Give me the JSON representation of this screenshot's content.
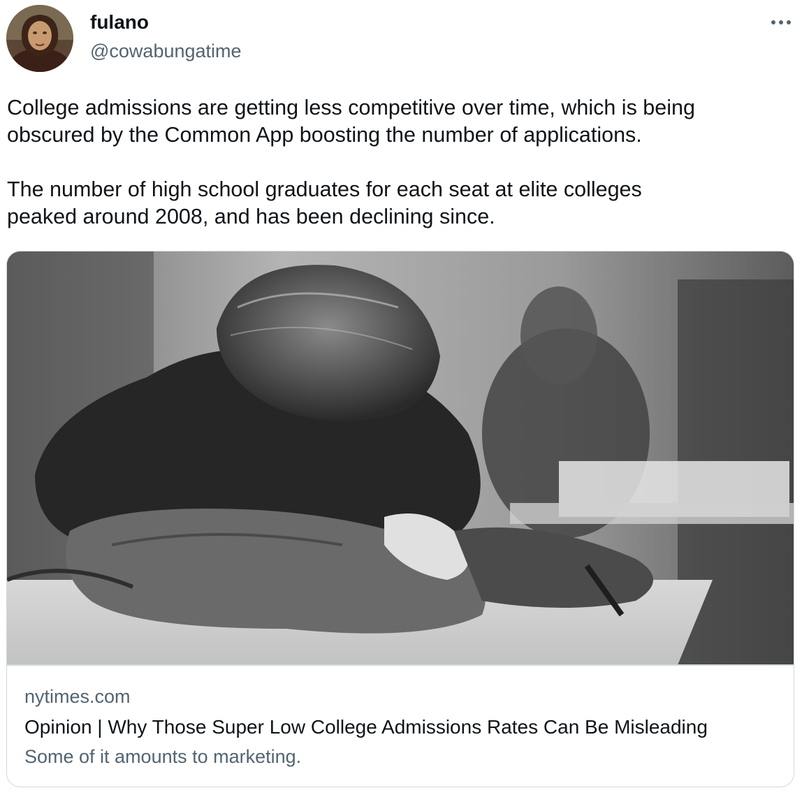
{
  "author": {
    "display_name": "fulano",
    "handle": "@cowabungatime",
    "avatar_icon": "painting-portrait-avatar"
  },
  "more_icon": "more-horizontal-icon",
  "tweet": {
    "paragraphs": [
      [
        "College admissions are getting less competitive over time, which is being",
        "obscured by the Common App boosting the number of applications."
      ],
      [
        "The number of high school graduates for each seat at elite colleges",
        "peaked around 2008, and has been declining since."
      ]
    ]
  },
  "link_card": {
    "image_icon": "student-head-on-desk-photo",
    "domain": "nytimes.com",
    "title": "Opinion | Why Those Super Low College Admissions Rates Can Be Misleading",
    "description": "Some of it amounts to marketing."
  },
  "colors": {
    "primary_text": "#0f1419",
    "secondary_text": "#536471",
    "border": "#cfd9de"
  }
}
